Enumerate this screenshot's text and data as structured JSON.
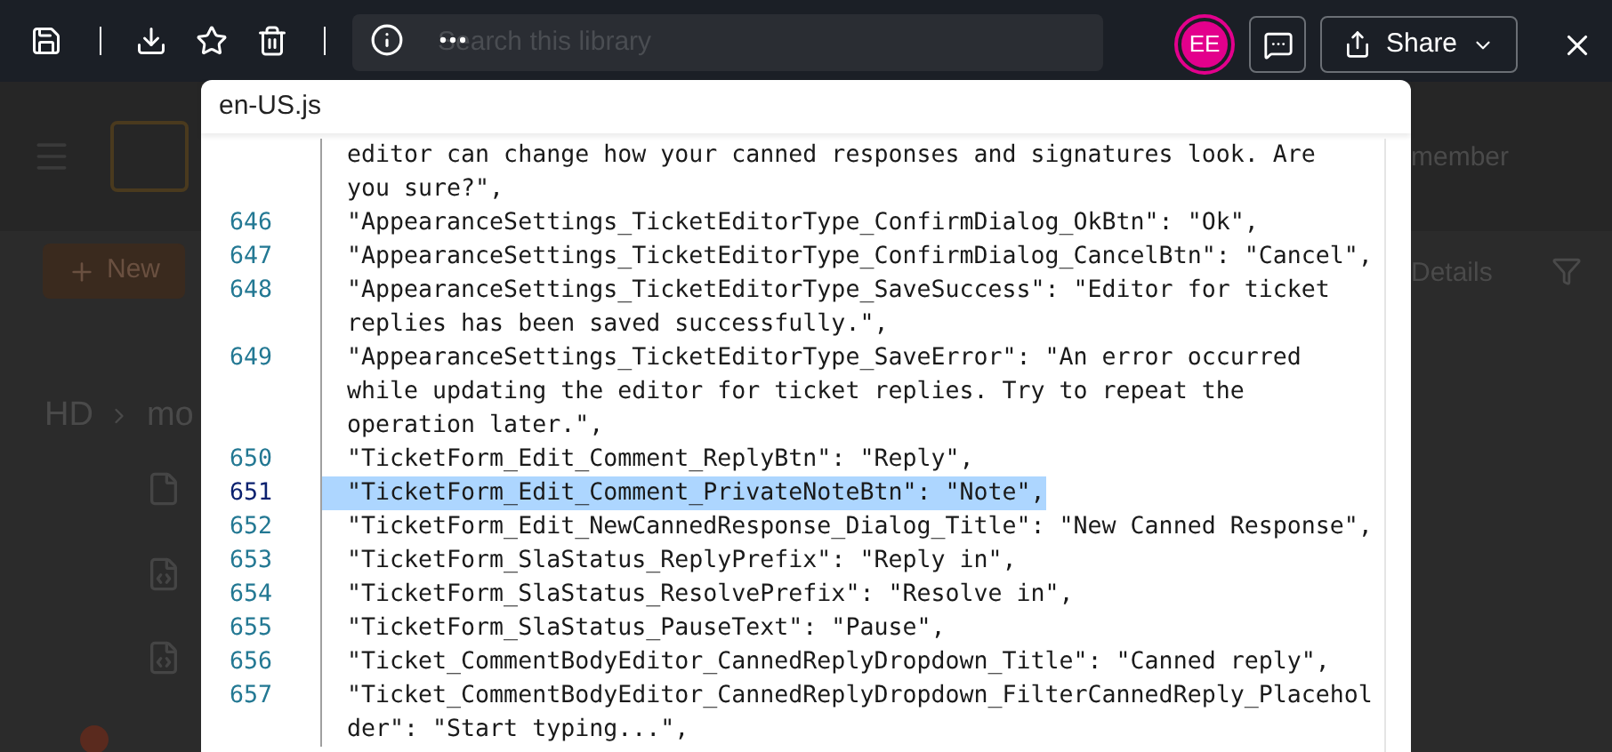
{
  "background_page": {
    "search": {
      "placeholder": "Search this library"
    },
    "header_text": "member",
    "new_button": "New",
    "details_button": "Details",
    "breadcrumb": [
      "HD",
      "mo"
    ]
  },
  "toolbar": {
    "avatar": "EE",
    "share_button": "Share"
  },
  "viewer": {
    "file_name": "en-US.js",
    "lines": [
      {
        "text": [
          "editor can change how your canned responses and signatures look. Are",
          "you sure?\","
        ],
        "selected": false
      },
      {
        "number": "646",
        "text": [
          "\"AppearanceSettings_TicketEditorType_ConfirmDialog_OkBtn\": \"Ok\","
        ],
        "selected": false
      },
      {
        "number": "647",
        "text": [
          "\"AppearanceSettings_TicketEditorType_ConfirmDialog_CancelBtn\": \"Cancel\","
        ],
        "selected": false
      },
      {
        "number": "648",
        "text": [
          "\"AppearanceSettings_TicketEditorType_SaveSuccess\": \"Editor for ticket",
          "replies has been saved successfully.\","
        ],
        "selected": false
      },
      {
        "number": "649",
        "text": [
          "\"AppearanceSettings_TicketEditorType_SaveError\": \"An error occurred",
          "while updating the editor for ticket replies. Try to repeat the",
          "operation later.\","
        ],
        "selected": false
      },
      {
        "number": "650",
        "text": [
          "\"TicketForm_Edit_Comment_ReplyBtn\": \"Reply\","
        ],
        "selected": false
      },
      {
        "number": "651",
        "text": [
          "\"TicketForm_Edit_Comment_PrivateNoteBtn\": \"Note\","
        ],
        "selected": true
      },
      {
        "number": "652",
        "text": [
          "\"TicketForm_Edit_NewCannedResponse_Dialog_Title\": \"New Canned Response\","
        ],
        "selected": false
      },
      {
        "number": "653",
        "text": [
          "\"TicketForm_SlaStatus_ReplyPrefix\": \"Reply in\","
        ],
        "selected": false
      },
      {
        "number": "654",
        "text": [
          "\"TicketForm_SlaStatus_ResolvePrefix\": \"Resolve in\","
        ],
        "selected": false
      },
      {
        "number": "655",
        "text": [
          "\"TicketForm_SlaStatus_PauseText\": \"Pause\","
        ],
        "selected": false
      },
      {
        "number": "656",
        "text": [
          "\"Ticket_CommentBodyEditor_CannedReplyDropdown_Title\": \"Canned reply\","
        ],
        "selected": false
      },
      {
        "number": "657",
        "text": [
          "\"Ticket_CommentBodyEditor_CannedReplyDropdown_FilterCannedReply_Placehol",
          "der\": \"Start typing...\","
        ],
        "selected": false
      }
    ]
  }
}
